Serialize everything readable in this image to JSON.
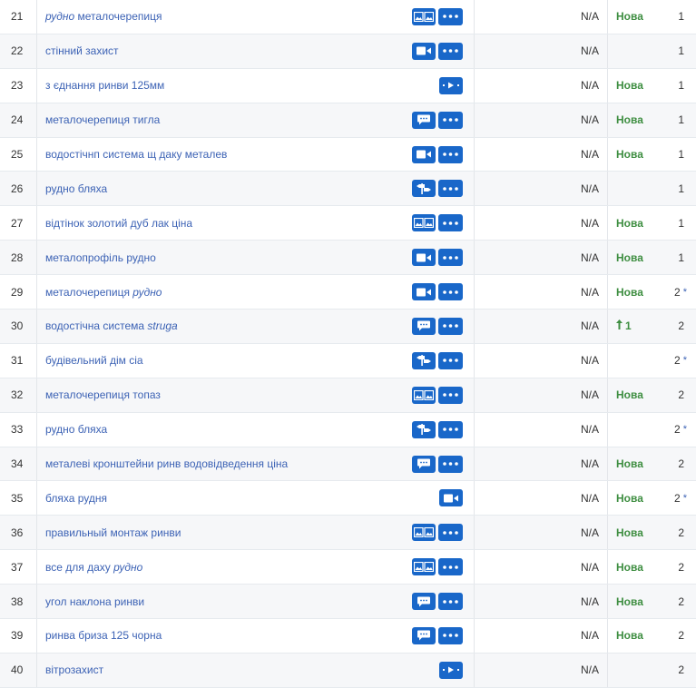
{
  "rows": [
    {
      "num": "21",
      "kw": [
        {
          "t": "рудно",
          "i": true
        },
        {
          "t": " металочерепиця",
          "i": false
        }
      ],
      "icon": "images-icon",
      "more": true,
      "na": "N/A",
      "change": "Нова",
      "pos": "1",
      "star": ""
    },
    {
      "num": "22",
      "kw": [
        {
          "t": "стінний захист",
          "i": false
        }
      ],
      "icon": "video-icon",
      "more": true,
      "na": "N/A",
      "change": "",
      "pos": "1",
      "star": ""
    },
    {
      "num": "23",
      "kw": [
        {
          "t": "з єднання ринви 125мм",
          "i": false
        }
      ],
      "icon": "carousel-icon",
      "more": false,
      "na": "N/A",
      "change": "Нова",
      "pos": "1",
      "star": ""
    },
    {
      "num": "24",
      "kw": [
        {
          "t": "металочерепиця тигла",
          "i": false
        }
      ],
      "icon": "chat-icon",
      "more": true,
      "na": "N/A",
      "change": "Нова",
      "pos": "1",
      "star": ""
    },
    {
      "num": "25",
      "kw": [
        {
          "t": "водостічнп система щ даку металев",
          "i": false
        }
      ],
      "icon": "video-icon",
      "more": true,
      "na": "N/A",
      "change": "Нова",
      "pos": "1",
      "star": ""
    },
    {
      "num": "26",
      "kw": [
        {
          "t": "рудно бляха",
          "i": false
        }
      ],
      "icon": "signpost-icon",
      "more": true,
      "na": "N/A",
      "change": "",
      "pos": "1",
      "star": ""
    },
    {
      "num": "27",
      "kw": [
        {
          "t": "відтінок золотий дуб лак ціна",
          "i": false
        }
      ],
      "icon": "images-icon",
      "more": true,
      "na": "N/A",
      "change": "Нова",
      "pos": "1",
      "star": ""
    },
    {
      "num": "28",
      "kw": [
        {
          "t": "металопрофіль рудно",
          "i": false
        }
      ],
      "icon": "video-icon",
      "more": true,
      "na": "N/A",
      "change": "Нова",
      "pos": "1",
      "star": ""
    },
    {
      "num": "29",
      "kw": [
        {
          "t": "металочерепиця ",
          "i": false
        },
        {
          "t": "рудно",
          "i": true
        }
      ],
      "icon": "video-icon",
      "more": true,
      "na": "N/A",
      "change": "Нова",
      "pos": "2",
      "star": "*"
    },
    {
      "num": "30",
      "kw": [
        {
          "t": "водостічна система ",
          "i": false
        },
        {
          "t": "struga",
          "i": true
        }
      ],
      "icon": "chat-icon",
      "more": true,
      "na": "N/A",
      "change": "1",
      "change_up": true,
      "pos": "2",
      "star": ""
    },
    {
      "num": "31",
      "kw": [
        {
          "t": "будівельний дім сіа",
          "i": false
        }
      ],
      "icon": "signpost-icon",
      "more": true,
      "na": "N/A",
      "change": "",
      "pos": "2",
      "star": "*"
    },
    {
      "num": "32",
      "kw": [
        {
          "t": "металочерепиця топаз",
          "i": false
        }
      ],
      "icon": "images-icon",
      "more": true,
      "na": "N/A",
      "change": "Нова",
      "pos": "2",
      "star": ""
    },
    {
      "num": "33",
      "kw": [
        {
          "t": "рудно бляха",
          "i": false
        }
      ],
      "icon": "signpost-icon",
      "more": true,
      "na": "N/A",
      "change": "",
      "pos": "2",
      "star": "*"
    },
    {
      "num": "34",
      "kw": [
        {
          "t": "металеві кронштейни ринв водовідведення ціна",
          "i": false
        }
      ],
      "icon": "chat-icon",
      "more": true,
      "na": "N/A",
      "change": "Нова",
      "pos": "2",
      "star": ""
    },
    {
      "num": "35",
      "kw": [
        {
          "t": "бляха рудня",
          "i": false
        }
      ],
      "icon": "video-icon",
      "more": false,
      "na": "N/A",
      "change": "Нова",
      "pos": "2",
      "star": "*"
    },
    {
      "num": "36",
      "kw": [
        {
          "t": "правильный монтаж ринви",
          "i": false
        }
      ],
      "icon": "images-icon",
      "more": true,
      "na": "N/A",
      "change": "Нова",
      "pos": "2",
      "star": ""
    },
    {
      "num": "37",
      "kw": [
        {
          "t": "все для даху ",
          "i": false
        },
        {
          "t": "рудно",
          "i": true
        }
      ],
      "icon": "images-icon",
      "more": true,
      "na": "N/A",
      "change": "Нова",
      "pos": "2",
      "star": ""
    },
    {
      "num": "38",
      "kw": [
        {
          "t": "угол наклона ринви",
          "i": false
        }
      ],
      "icon": "chat-icon",
      "more": true,
      "na": "N/A",
      "change": "Нова",
      "pos": "2",
      "star": ""
    },
    {
      "num": "39",
      "kw": [
        {
          "t": "ринва бриза 125 чорна",
          "i": false
        }
      ],
      "icon": "chat-icon",
      "more": true,
      "na": "N/A",
      "change": "Нова",
      "pos": "2",
      "star": ""
    },
    {
      "num": "40",
      "kw": [
        {
          "t": "вітрозахист",
          "i": false
        }
      ],
      "icon": "carousel-icon",
      "more": false,
      "na": "N/A",
      "change": "",
      "pos": "2",
      "star": ""
    }
  ],
  "colors": {
    "accent": "#1967c9",
    "link": "#3d63b5",
    "new": "#3e8e41"
  }
}
